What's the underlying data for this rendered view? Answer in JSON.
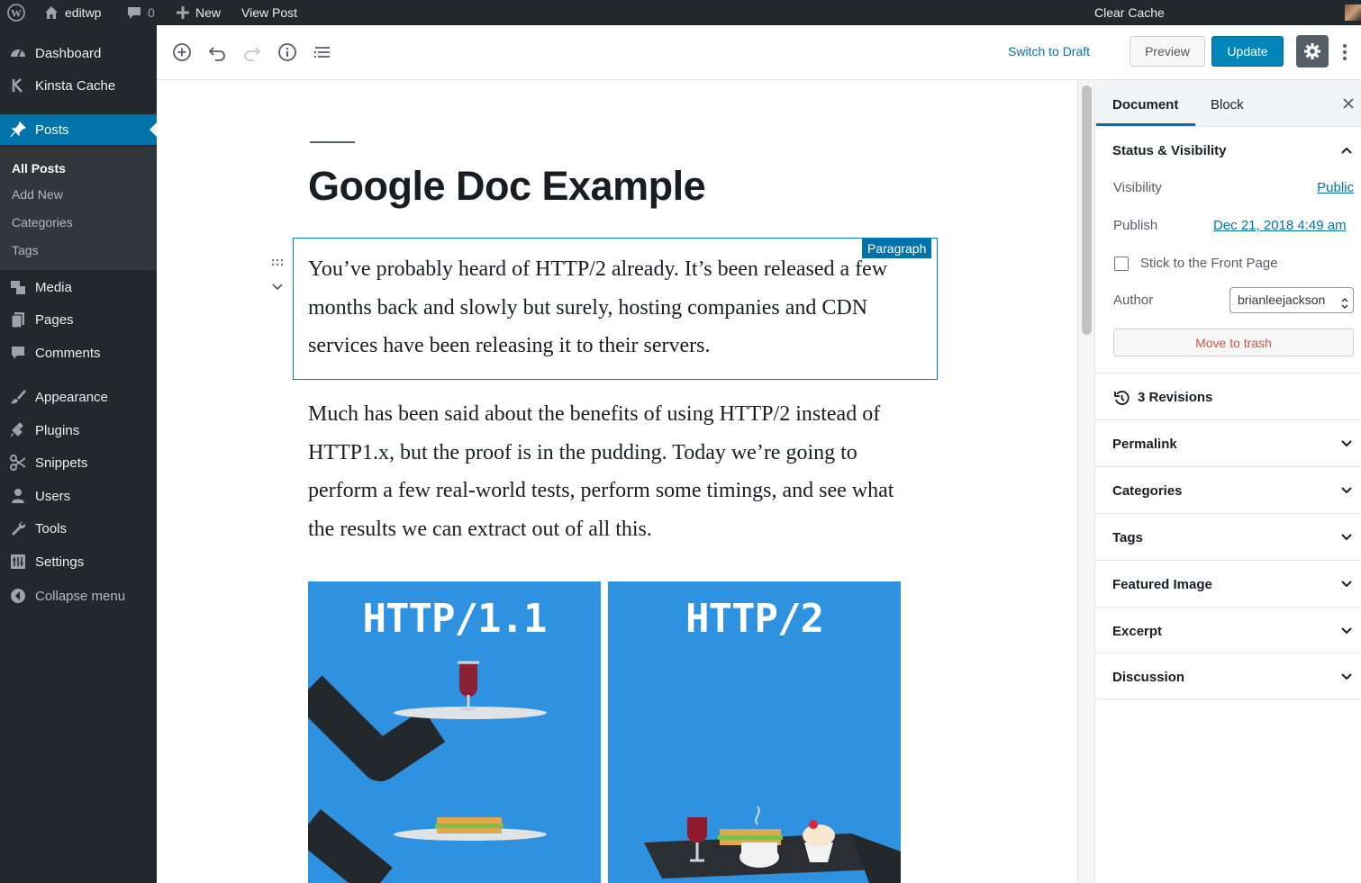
{
  "admin_bar": {
    "site_name": "editwp",
    "comments_count": "0",
    "new_label": "New",
    "view_post_label": "View Post",
    "clear_cache_label": "Clear Cache"
  },
  "sidebar": {
    "items": [
      {
        "label": "Dashboard",
        "icon": "dashboard-icon"
      },
      {
        "label": "Kinsta Cache",
        "icon": "kinsta-icon"
      },
      {
        "label": "Posts",
        "icon": "pin-icon"
      },
      {
        "label": "Media",
        "icon": "media-icon"
      },
      {
        "label": "Pages",
        "icon": "pages-icon"
      },
      {
        "label": "Comments",
        "icon": "comment-icon"
      },
      {
        "label": "Appearance",
        "icon": "brush-icon"
      },
      {
        "label": "Plugins",
        "icon": "plugin-icon"
      },
      {
        "label": "Snippets",
        "icon": "scissors-icon"
      },
      {
        "label": "Users",
        "icon": "user-icon"
      },
      {
        "label": "Tools",
        "icon": "wrench-icon"
      },
      {
        "label": "Settings",
        "icon": "settings-icon"
      },
      {
        "label": "Collapse menu",
        "icon": "collapse-icon"
      }
    ],
    "posts_submenu": [
      "All Posts",
      "Add New",
      "Categories",
      "Tags"
    ]
  },
  "toolbar": {
    "switch_to_draft": "Switch to Draft",
    "preview": "Preview",
    "update": "Update"
  },
  "editor": {
    "title": "Google Doc Example",
    "block_label": "Paragraph",
    "paragraph_1": "You’ve probably heard of HTTP/2 already. It’s been released a few months back and slowly but surely, hosting companies and CDN services have been releasing it to their servers.",
    "paragraph_2": "Much has been said about the benefits of using HTTP/2 instead of HTTP1.x, but the proof is in the pudding. Today we’re going to perform a few real-world tests, perform some timings, and see what the results we can extract out of all this.",
    "image_left_title": "HTTP/1.1",
    "image_right_title": "HTTP/2"
  },
  "settings_sidebar": {
    "tab_document": "Document",
    "tab_block": "Block",
    "status_visibility": "Status & Visibility",
    "visibility_label": "Visibility",
    "visibility_value": "Public",
    "publish_label": "Publish",
    "publish_value": "Dec 21, 2018 4:49 am",
    "sticky_label": "Stick to the Front Page",
    "author_label": "Author",
    "author_value": "brianleejackson",
    "trash_label": "Move to trash",
    "revisions_label": "3 Revisions",
    "panels": [
      "Permalink",
      "Categories",
      "Tags",
      "Featured Image",
      "Excerpt",
      "Discussion"
    ]
  },
  "colors": {
    "admin_dark": "#23282d",
    "accent": "#0073aa",
    "update_button": "#0085ba",
    "image_blue": "#2f92e0",
    "trash_red": "#d94f4f"
  }
}
